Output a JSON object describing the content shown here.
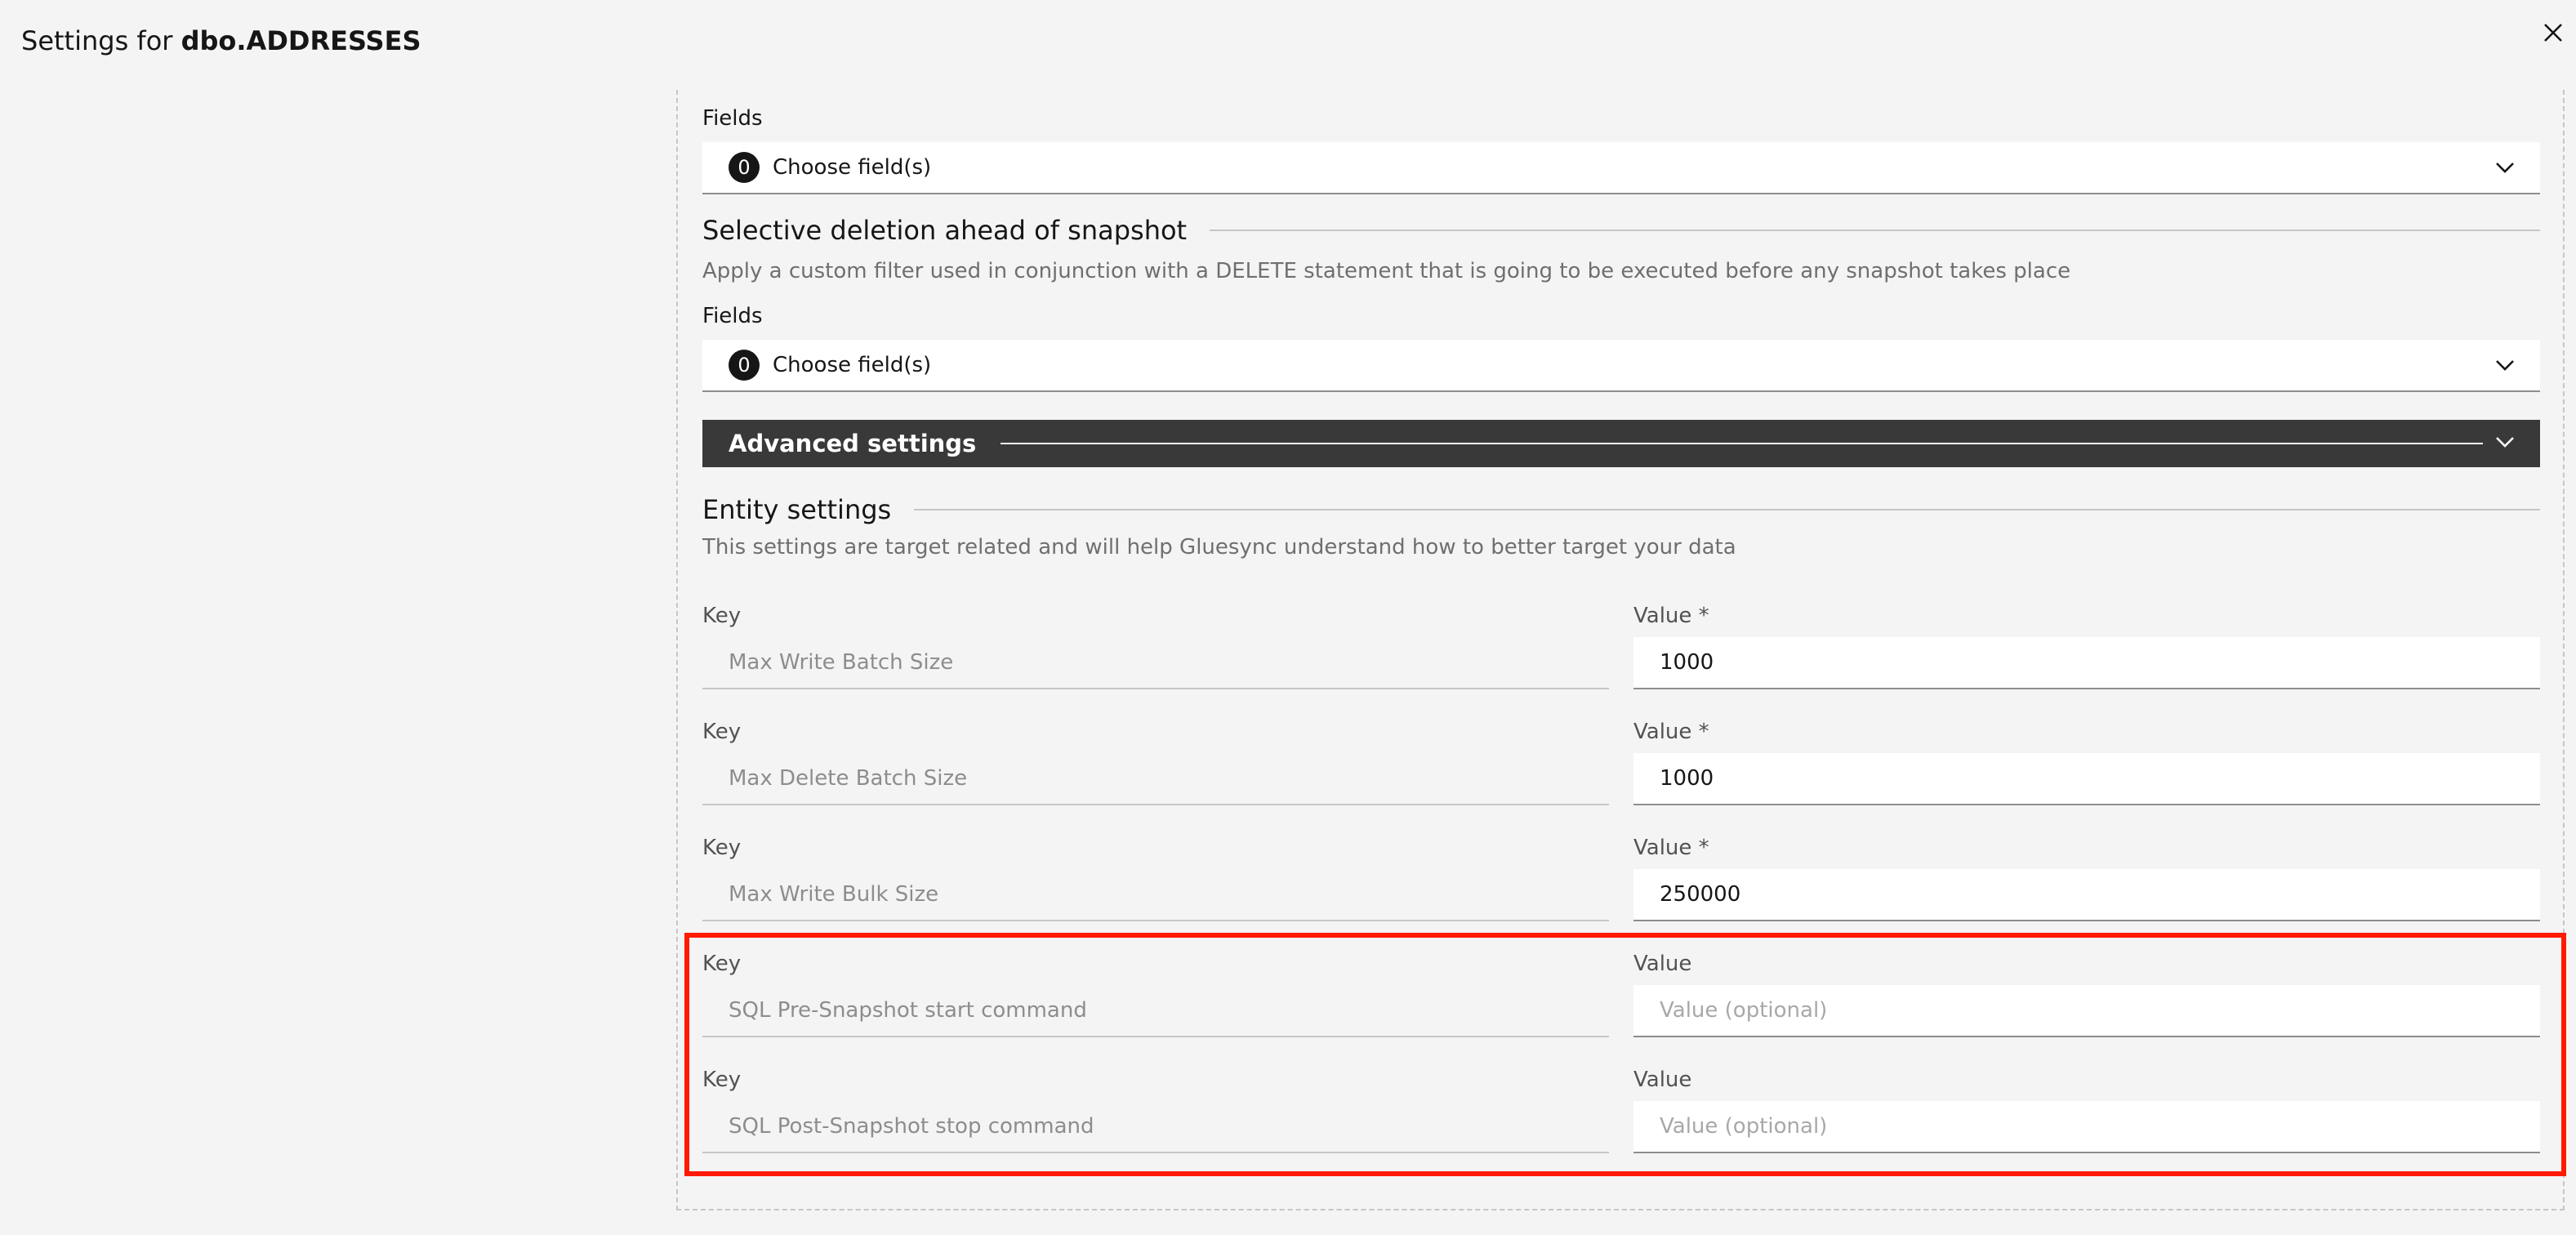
{
  "header": {
    "title_prefix": "Settings for",
    "title_entity": "dbo.ADDRESSES",
    "close_icon": "close-icon"
  },
  "fields_select_1": {
    "label": "Fields",
    "count": "0",
    "placeholder": "Choose field(s)"
  },
  "selective_deletion": {
    "heading": "Selective deletion ahead of snapshot",
    "description": "Apply a custom filter used in conjunction with a DELETE statement that is going to be executed before any snapshot takes place",
    "fields_label": "Fields",
    "count": "0",
    "placeholder": "Choose field(s)"
  },
  "advanced": {
    "label": "Advanced settings",
    "expanded": true
  },
  "entity_settings": {
    "heading": "Entity settings",
    "description": "This settings are target related and will help Gluesync understand how to better target your data",
    "rows": [
      {
        "key_label": "Key",
        "key": "Max Write Batch Size",
        "value_label": "Value *",
        "value": "1000",
        "placeholder": ""
      },
      {
        "key_label": "Key",
        "key": "Max Delete Batch Size",
        "value_label": "Value *",
        "value": "1000",
        "placeholder": ""
      },
      {
        "key_label": "Key",
        "key": "Max Write Bulk Size",
        "value_label": "Value *",
        "value": "250000",
        "placeholder": ""
      },
      {
        "key_label": "Key",
        "key": "SQL Pre-Snapshot start command",
        "value_label": "Value",
        "value": "",
        "placeholder": "Value (optional)"
      },
      {
        "key_label": "Key",
        "key": "SQL Post-Snapshot stop command",
        "value_label": "Value",
        "value": "",
        "placeholder": "Value (optional)"
      }
    ]
  },
  "colors": {
    "background": "#f4f4f4",
    "advanced_bar": "#393939",
    "highlight": "#ff1a00"
  }
}
